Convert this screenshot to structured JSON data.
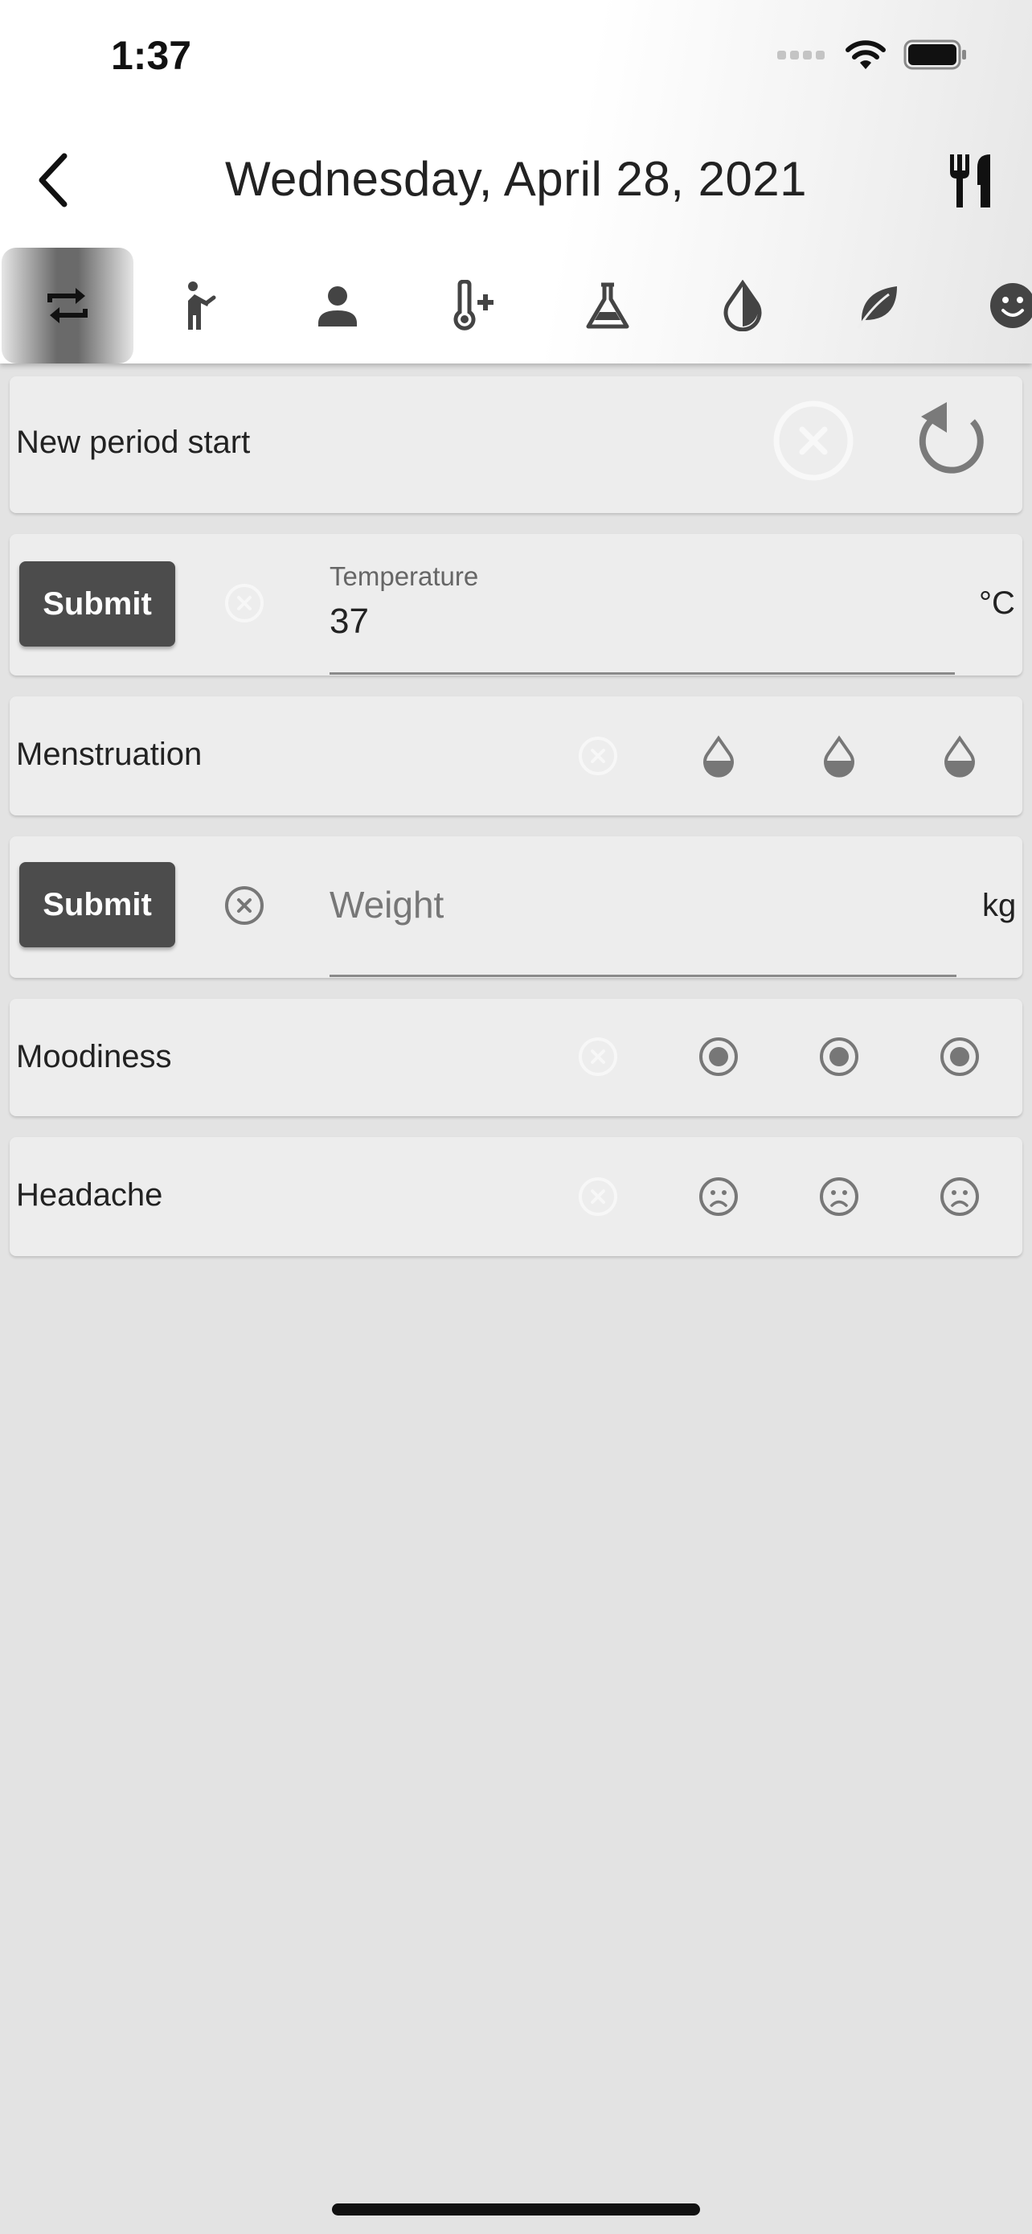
{
  "status_bar": {
    "time": "1:37"
  },
  "nav": {
    "title": "Wednesday, April 28, 2021",
    "back_icon": "chevron-left-icon",
    "right_icon": "fork-knife-icon"
  },
  "tabs": [
    {
      "icon": "repeat-icon",
      "active": true
    },
    {
      "icon": "stretching-person-icon",
      "active": false
    },
    {
      "icon": "person-icon",
      "active": false
    },
    {
      "icon": "thermometer-plus-icon",
      "active": false
    },
    {
      "icon": "flask-icon",
      "active": false
    },
    {
      "icon": "half-drop-icon",
      "active": false
    },
    {
      "icon": "leaf-icon",
      "active": false
    },
    {
      "icon": "smiley-icon",
      "active": false
    }
  ],
  "period": {
    "label": "New period start",
    "clear_icon": "cancel-circle-icon",
    "reset_icon": "refresh-icon"
  },
  "temperature": {
    "submit_label": "Submit",
    "field_label": "Temperature",
    "value": "37",
    "unit": "°C"
  },
  "menstruation": {
    "label": "Menstruation",
    "options": [
      "none",
      "drop-light",
      "drop-medium",
      "drop-heavy"
    ]
  },
  "weight": {
    "submit_label": "Submit",
    "placeholder": "Weight",
    "unit": "kg"
  },
  "moodiness": {
    "label": "Moodiness",
    "options": [
      "none",
      "low",
      "medium",
      "high"
    ]
  },
  "headache": {
    "label": "Headache",
    "options": [
      "none",
      "low",
      "medium",
      "high"
    ]
  },
  "colors": {
    "primary": "#4c4c4c",
    "card": "#ededed",
    "background": "#e3e3e3"
  }
}
